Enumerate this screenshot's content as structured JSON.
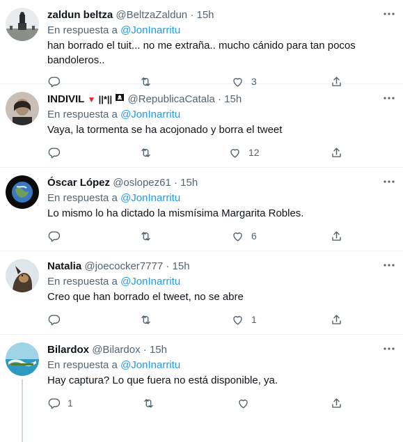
{
  "replying_to_prefix": "En respuesta a",
  "tweets": [
    {
      "name": "zaldun beltza",
      "handle": "@BeltzaZaldun",
      "time": "· 15h",
      "mention": "@JonInarritu",
      "text_line1": "han borrado el tuit... no me extraña.. mucho cánido para tan pocos",
      "text_line2": "bandoleros..",
      "reply_count": "",
      "retweet_count": "",
      "like_count": "3"
    },
    {
      "name": "INDIVIL",
      "name_suffix": "||*||",
      "handle": "@RepublicaCatala",
      "time": "· 15h",
      "mention": "@JonInarritu",
      "text_line1": "Vaya, la tormenta se ha acojonado y borra el tweet",
      "reply_count": "",
      "retweet_count": "",
      "like_count": "12"
    },
    {
      "name": "Óscar López",
      "handle": "@oslopez61",
      "time": "· 15h",
      "mention": "@JonInarritu",
      "text_line1": "Lo mismo lo ha dictado la mismísima Margarita Robles.",
      "reply_count": "",
      "retweet_count": "",
      "like_count": "6"
    },
    {
      "name": "Natalia",
      "handle": "@joecocker7777",
      "time": "· 15h",
      "mention": "@JonInarritu",
      "text_line1": "Creo que han borrado el tweet, no se abre",
      "reply_count": "",
      "retweet_count": "",
      "like_count": "1"
    },
    {
      "name": "Bilardox",
      "handle": "@Bilardox",
      "time": "· 15h",
      "mention": "@JonInarritu",
      "text_line1": "Hay captura? Lo que fuera no está disponible, ya.",
      "reply_count": "1",
      "retweet_count": "",
      "like_count": ""
    }
  ],
  "icons": {
    "reply": "reply-icon",
    "retweet": "retweet-icon",
    "like": "heart-icon",
    "share": "share-icon",
    "more": "more-icon"
  },
  "colors": {
    "mention": "#1d9bf0",
    "secondary_text": "#536471",
    "divider": "#eff3f4",
    "thread_line": "#cfd9de"
  }
}
